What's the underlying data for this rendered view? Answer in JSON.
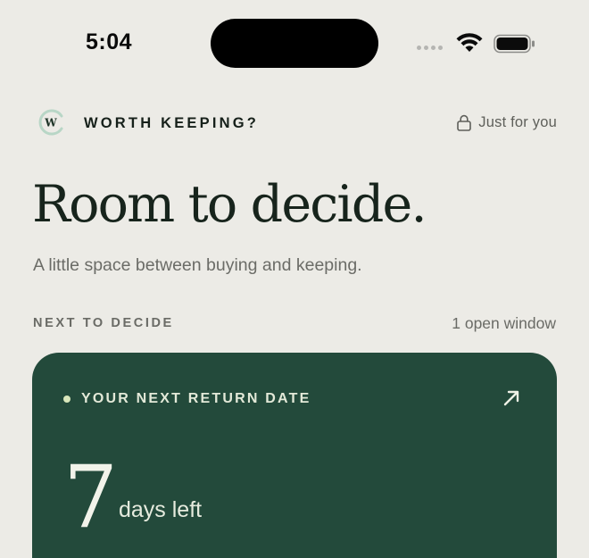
{
  "status_bar": {
    "time": "5:04",
    "icons": [
      "signal-dots-icon",
      "wifi-icon",
      "battery-icon"
    ]
  },
  "brand": {
    "logo_letter": "W",
    "name": "WORTH KEEPING?",
    "privacy_label": "Just for you",
    "privacy_icon": "lock-icon"
  },
  "hero": {
    "title": "Room to decide.",
    "subtitle": "A little space between buying and keeping."
  },
  "section": {
    "label": "NEXT TO DECIDE",
    "count": "1 open window"
  },
  "card": {
    "eyebrow": "YOUR NEXT RETURN DATE",
    "days": "7",
    "days_label": "days left",
    "arrow_icon": "arrow-up-right-icon"
  },
  "colors": {
    "background": "#ecebe6",
    "card": "#234a3b",
    "accent_dot": "#d9e7bb",
    "text_dark": "#17241c",
    "text_muted": "#6b6c67"
  }
}
